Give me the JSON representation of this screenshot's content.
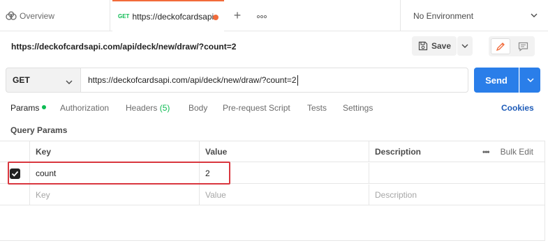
{
  "tabs": {
    "overview_label": "Overview",
    "active_method": "GET",
    "active_label": "https://deckofcardsapi",
    "add_glyph": "+",
    "more_glyph": "ooo"
  },
  "environment": {
    "label": "No Environment"
  },
  "request": {
    "title": "https://deckofcardsapi.com/api/deck/new/draw/?count=2",
    "save_label": "Save",
    "method": "GET",
    "url": "https://deckofcardsapi.com/api/deck/new/draw/?count=2",
    "send_label": "Send"
  },
  "request_tabs": [
    {
      "label": "Params",
      "active": true
    },
    {
      "label": "Authorization"
    },
    {
      "label": "Headers",
      "count": "(5)"
    },
    {
      "label": "Body"
    },
    {
      "label": "Pre-request Script"
    },
    {
      "label": "Tests"
    },
    {
      "label": "Settings"
    }
  ],
  "cookies_label": "Cookies",
  "query_params": {
    "title": "Query Params",
    "headers": {
      "key": "Key",
      "value": "Value",
      "description": "Description",
      "bulk_edit": "Bulk Edit",
      "more": "•••"
    },
    "rows": [
      {
        "checked": true,
        "key": "count",
        "value": "2",
        "description": ""
      }
    ],
    "placeholders": {
      "key": "Key",
      "value": "Value",
      "description": "Description"
    }
  },
  "colors": {
    "accent_orange": "#f26b3a",
    "send_blue": "#2a7ee9",
    "method_green": "#0cbb52",
    "highlight_red": "#d9363e"
  },
  "icons": [
    "overview-icon",
    "plus-icon",
    "more-icon",
    "chevron-down-icon",
    "save-icon",
    "pencil-icon",
    "comment-icon",
    "checkmark-icon"
  ]
}
